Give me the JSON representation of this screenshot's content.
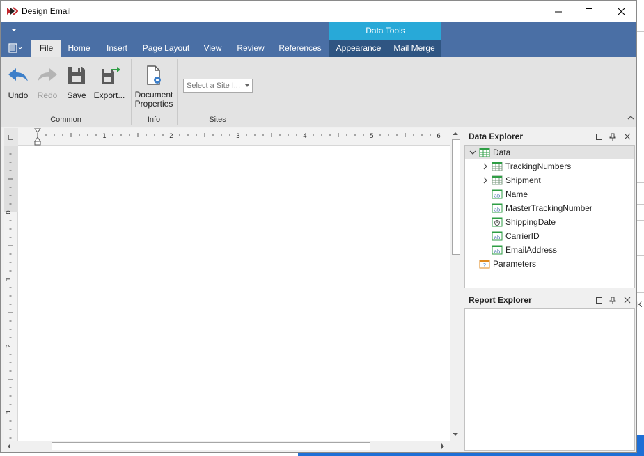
{
  "window": {
    "title": "Design Email"
  },
  "ribbon": {
    "contextual_group": "Data Tools",
    "tabs": [
      {
        "label": "File",
        "active": true
      },
      {
        "label": "Home"
      },
      {
        "label": "Insert"
      },
      {
        "label": "Page Layout"
      },
      {
        "label": "View"
      },
      {
        "label": "Review"
      },
      {
        "label": "References"
      },
      {
        "label": "Appearance"
      },
      {
        "label": "Mail Merge"
      }
    ],
    "buttons": {
      "undo": "Undo",
      "redo": "Redo",
      "save": "Save",
      "export": "Export...",
      "doc_props_line1": "Document",
      "doc_props_line2": "Properties"
    },
    "site_combo_placeholder": "Select a Site I...",
    "groups": {
      "common": "Common",
      "info": "Info",
      "sites": "Sites"
    }
  },
  "ruler": {
    "h_ticks": [
      "1",
      "2",
      "3",
      "4",
      "5",
      "6"
    ],
    "v_ticks": [
      "0",
      "1",
      "2",
      "3"
    ]
  },
  "data_explorer": {
    "title": "Data Explorer",
    "root": "Data",
    "items": [
      {
        "label": "TrackingNumbers",
        "kind": "table",
        "expandable": true
      },
      {
        "label": "Shipment",
        "kind": "table",
        "expandable": true
      },
      {
        "label": "Name",
        "kind": "text"
      },
      {
        "label": "MasterTrackingNumber",
        "kind": "text"
      },
      {
        "label": "ShippingDate",
        "kind": "date"
      },
      {
        "label": "CarrierID",
        "kind": "text"
      },
      {
        "label": "EmailAddress",
        "kind": "text"
      }
    ],
    "parameters": "Parameters"
  },
  "report_explorer": {
    "title": "Report Explorer"
  },
  "background": {
    "fragment": "K"
  },
  "colors": {
    "ribbon_blue": "#4a6fa5",
    "contextual_cyan": "#28a9d8",
    "contextual_dark": "#2f5582"
  }
}
